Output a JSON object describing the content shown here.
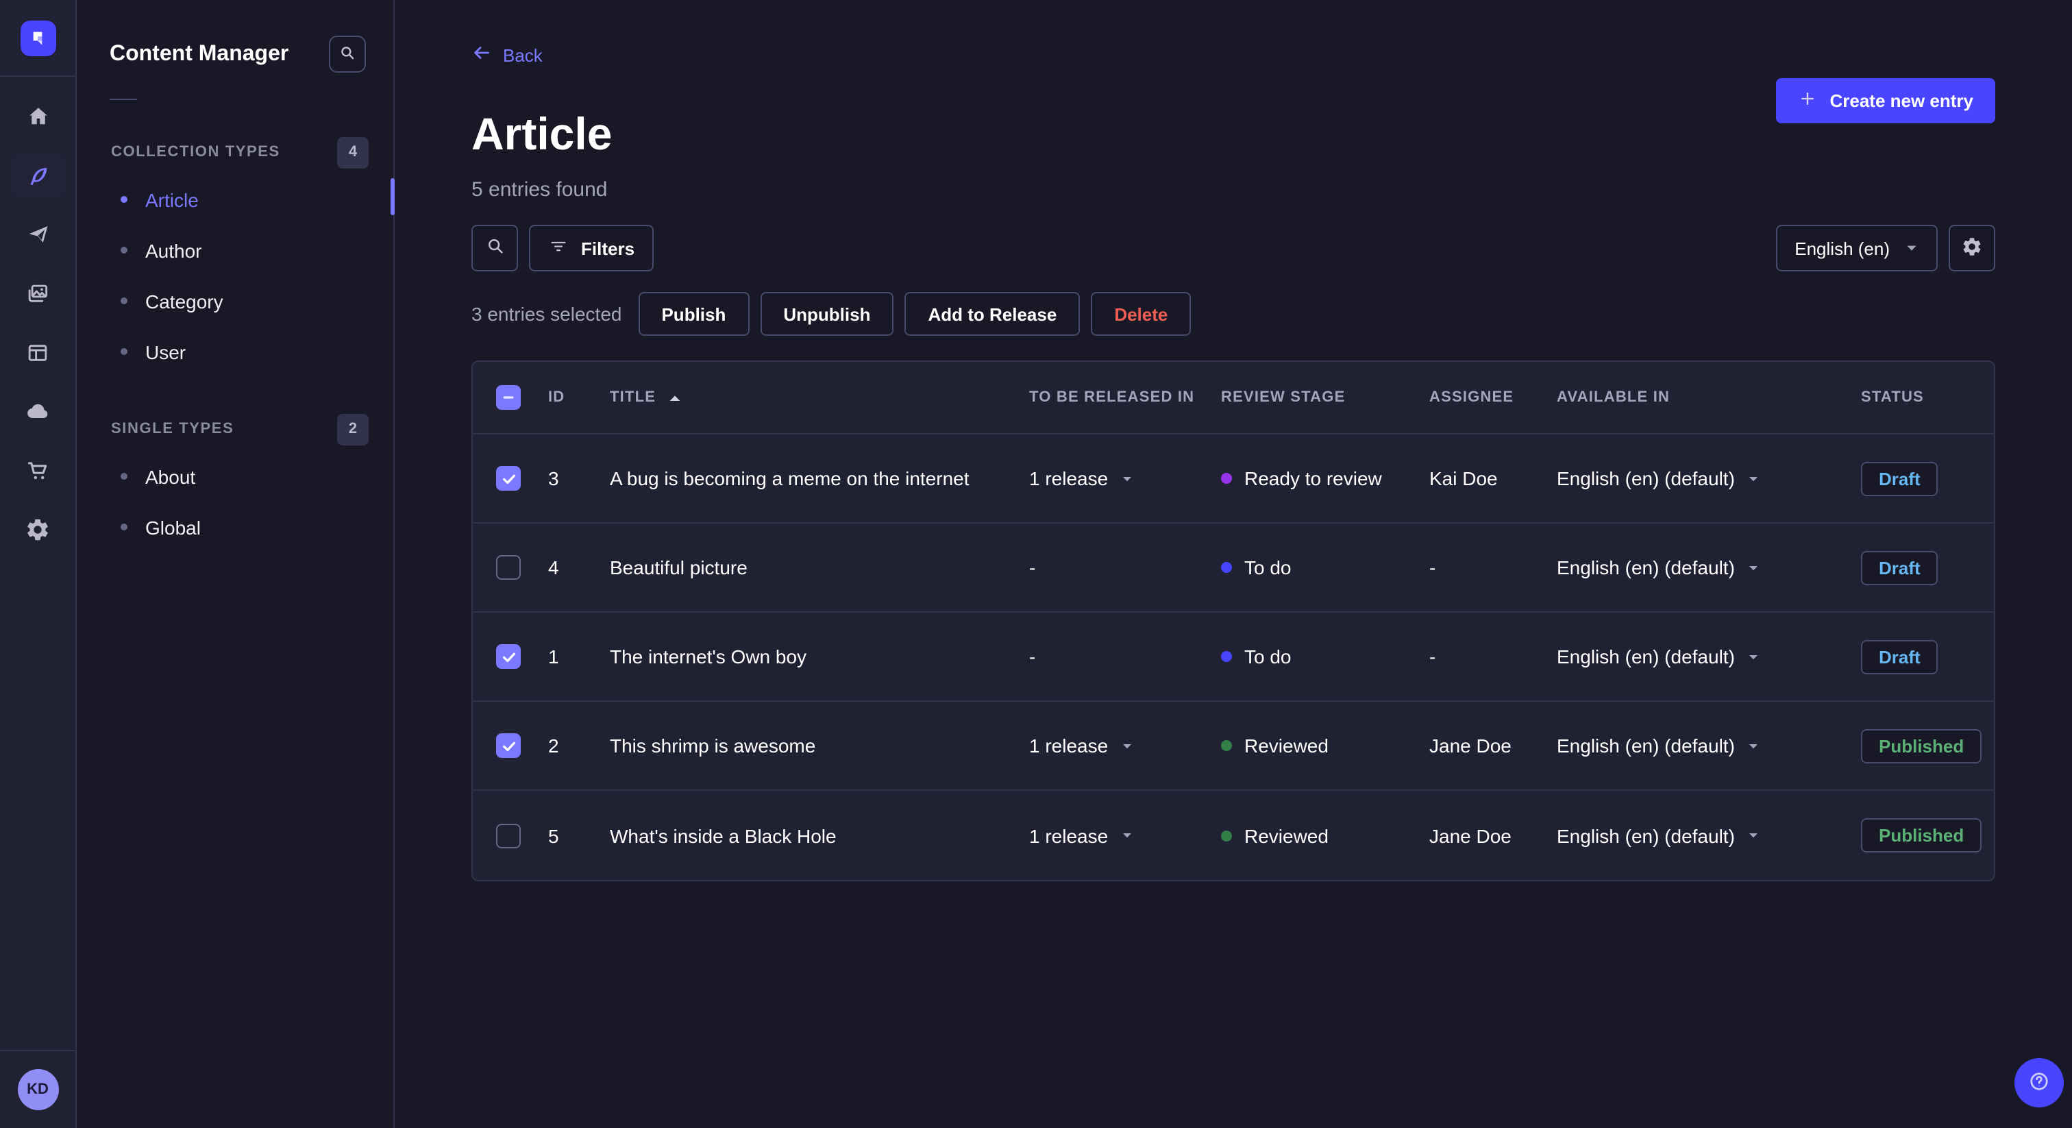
{
  "app": {
    "background": "#181826",
    "panel": "#212134",
    "accent": "#4945ff",
    "accent_light": "#7b79ff"
  },
  "nav": {
    "logo_icon": "strapi-logo",
    "items": [
      {
        "name": "home",
        "active": false
      },
      {
        "name": "content-manager",
        "active": true
      },
      {
        "name": "releases",
        "active": false
      },
      {
        "name": "media-library",
        "active": false
      },
      {
        "name": "content-type-builder",
        "active": false
      },
      {
        "name": "deploy",
        "active": false
      },
      {
        "name": "marketplace",
        "active": false
      },
      {
        "name": "settings",
        "active": false
      }
    ],
    "avatar_initials": "KD"
  },
  "sidebar": {
    "title": "Content Manager",
    "sections": [
      {
        "label": "COLLECTION TYPES",
        "count": "4",
        "items": [
          {
            "label": "Article",
            "active": true
          },
          {
            "label": "Author",
            "active": false
          },
          {
            "label": "Category",
            "active": false
          },
          {
            "label": "User",
            "active": false
          }
        ]
      },
      {
        "label": "SINGLE TYPES",
        "count": "2",
        "items": [
          {
            "label": "About",
            "active": false
          },
          {
            "label": "Global",
            "active": false
          }
        ]
      }
    ]
  },
  "header": {
    "back_label": "Back",
    "title": "Article",
    "subtitle": "5 entries found",
    "create_label": "Create new entry"
  },
  "toolbar": {
    "filters_label": "Filters",
    "locale_value": "English (en)"
  },
  "selection": {
    "summary": "3 entries selected",
    "publish_label": "Publish",
    "unpublish_label": "Unpublish",
    "add_to_release_label": "Add to Release",
    "delete_label": "Delete",
    "delete_color": "#ee5e52"
  },
  "table": {
    "columns": {
      "id": "ID",
      "title": "TITLE",
      "released": "TO BE RELEASED IN",
      "review": "REVIEW STAGE",
      "assignee": "ASSIGNEE",
      "available": "AVAILABLE IN",
      "status": "STATUS"
    },
    "sort": {
      "column": "TITLE",
      "direction": "asc"
    },
    "header_checkbox_state": "indeterminate",
    "status_colors": {
      "Draft": "#66b7f1",
      "Published": "#5cb176"
    },
    "rows": [
      {
        "selected": true,
        "id": "3",
        "title": "A bug is becoming a meme on the internet",
        "to_be_released_in": "1 release",
        "review_stage": "Ready to review",
        "review_stage_color": "#9736e8",
        "assignee": "Kai Doe",
        "available_in": "English (en) (default)",
        "status": "Draft"
      },
      {
        "selected": false,
        "id": "4",
        "title": "Beautiful picture",
        "to_be_released_in": "-",
        "review_stage": "To do",
        "review_stage_color": "#4945ff",
        "assignee": "-",
        "available_in": "English (en) (default)",
        "status": "Draft"
      },
      {
        "selected": true,
        "id": "1",
        "title": "The internet's Own boy",
        "to_be_released_in": "-",
        "review_stage": "To do",
        "review_stage_color": "#4945ff",
        "assignee": "-",
        "available_in": "English (en) (default)",
        "status": "Draft"
      },
      {
        "selected": true,
        "id": "2",
        "title": "This shrimp is awesome",
        "to_be_released_in": "1 release",
        "review_stage": "Reviewed",
        "review_stage_color": "#328048",
        "assignee": "Jane Doe",
        "available_in": "English (en) (default)",
        "status": "Published"
      },
      {
        "selected": false,
        "id": "5",
        "title": "What's inside a Black Hole",
        "to_be_released_in": "1 release",
        "review_stage": "Reviewed",
        "review_stage_color": "#328048",
        "assignee": "Jane Doe",
        "available_in": "English (en) (default)",
        "status": "Published"
      }
    ]
  }
}
